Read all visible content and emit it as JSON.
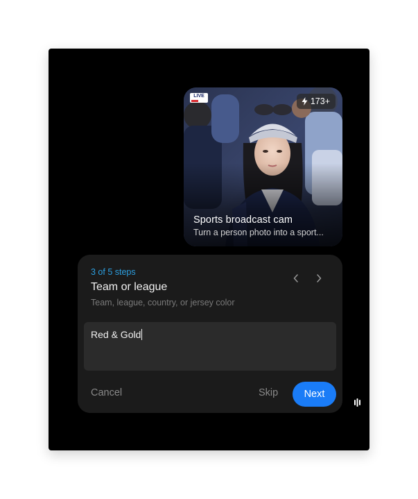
{
  "card": {
    "live_badge": "LIVE",
    "usage_count": "173+",
    "usage_icon": "bolt-icon",
    "title": "Sports broadcast cam",
    "description": "Turn a person photo into a sport..."
  },
  "step": {
    "progress": "3 of 5 steps",
    "title": "Team or league",
    "hint": "Team, league, country, or jersey color",
    "prev_icon": "chevron-left-icon",
    "next_icon": "chevron-right-icon"
  },
  "input": {
    "value": "Red & Gold"
  },
  "actions": {
    "cancel_label": "Cancel",
    "skip_label": "Skip",
    "next_label": "Next"
  },
  "colors": {
    "accent": "#1a7cf7",
    "step_count": "#2c9fe0",
    "panel": "#1b1b1b",
    "input_bg": "#2b2b2b"
  }
}
